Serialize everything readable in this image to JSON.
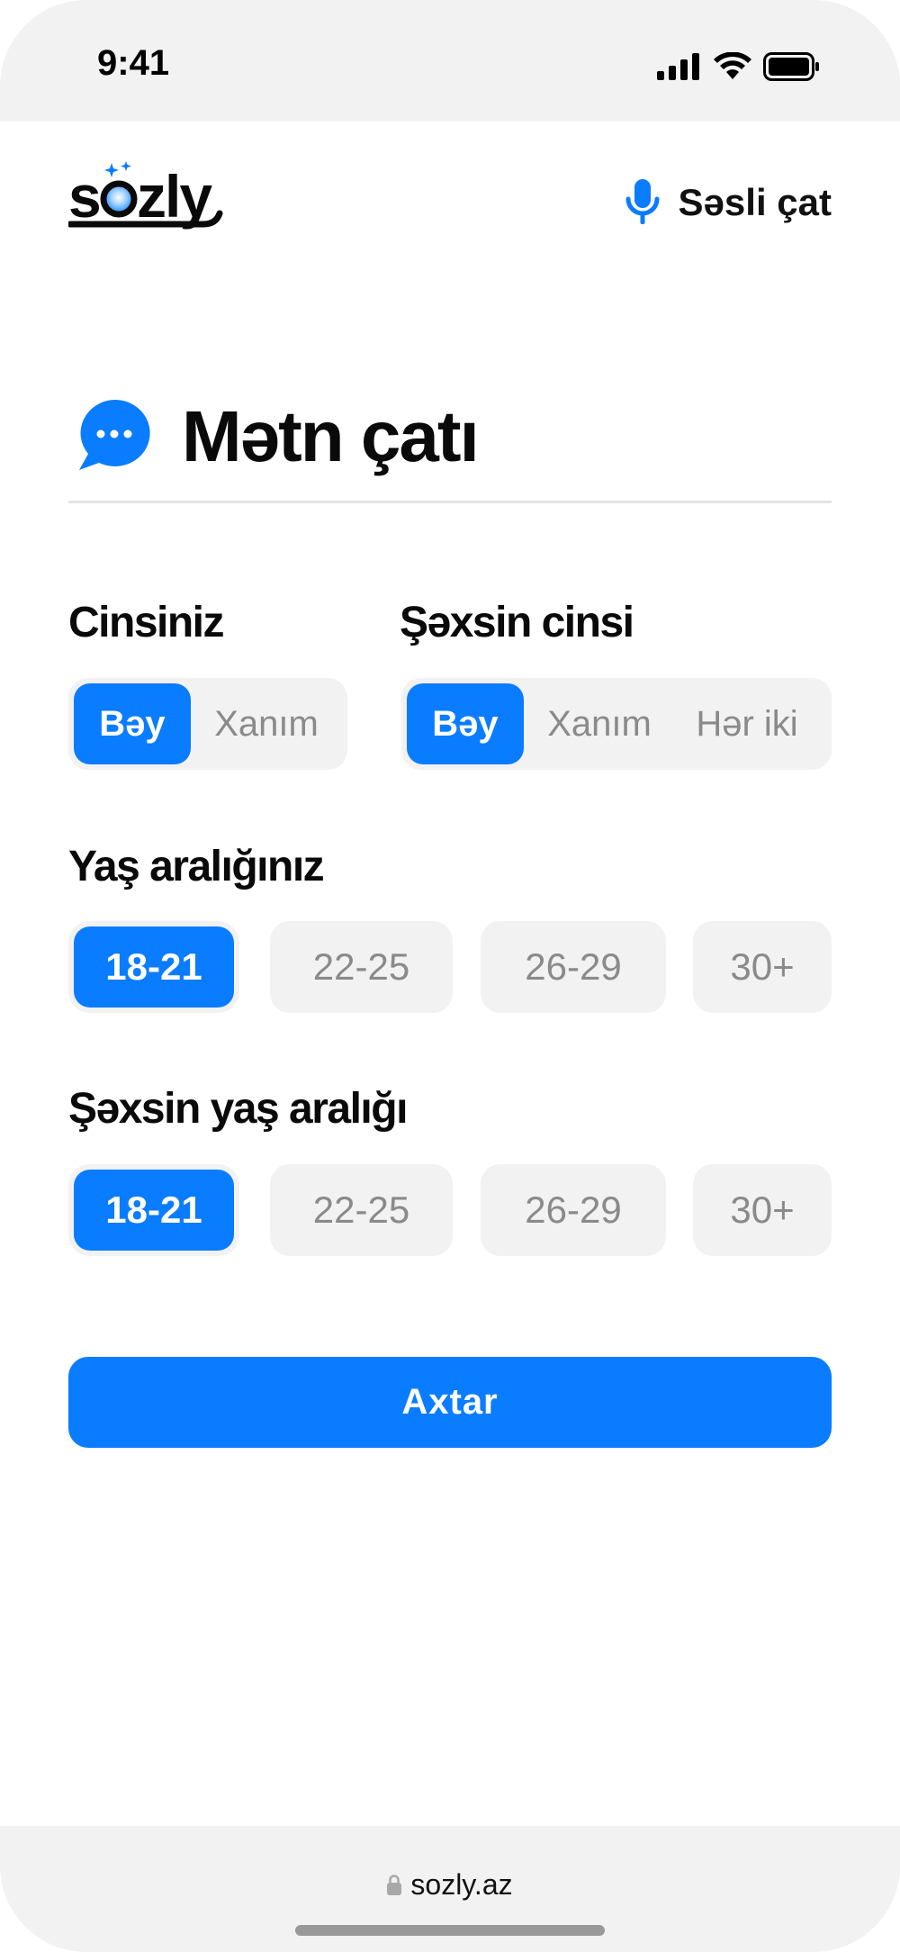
{
  "status_bar": {
    "time": "9:41"
  },
  "header": {
    "logo_text": "sozly",
    "voice_chat_label": "Səsli çat",
    "voice_icon": "microphone-icon"
  },
  "page": {
    "title": "Mətn çatı",
    "title_icon": "chat-bubble-icon"
  },
  "your_gender": {
    "label": "Cinsiniz",
    "options": [
      "Bəy",
      "Xanım"
    ],
    "selected": "Bəy"
  },
  "partner_gender": {
    "label": "Şəxsin cinsi",
    "options": [
      "Bəy",
      "Xanım",
      "Hər iki"
    ],
    "selected": "Bəy"
  },
  "your_age": {
    "label": "Yaş aralığınız",
    "options": [
      "18-21",
      "22-25",
      "26-29",
      "30+"
    ],
    "selected": "18-21"
  },
  "partner_age": {
    "label": "Şəxsin yaş aralığı",
    "options": [
      "18-21",
      "22-25",
      "26-29",
      "30+"
    ],
    "selected": "18-21"
  },
  "search_button": {
    "label": "Axtar"
  },
  "browser": {
    "url": "sozly.az",
    "lock_icon": "lock-icon"
  },
  "colors": {
    "accent": "#0a7cff",
    "chip_bg": "#f2f2f2",
    "muted_text": "#8a8a8a"
  }
}
